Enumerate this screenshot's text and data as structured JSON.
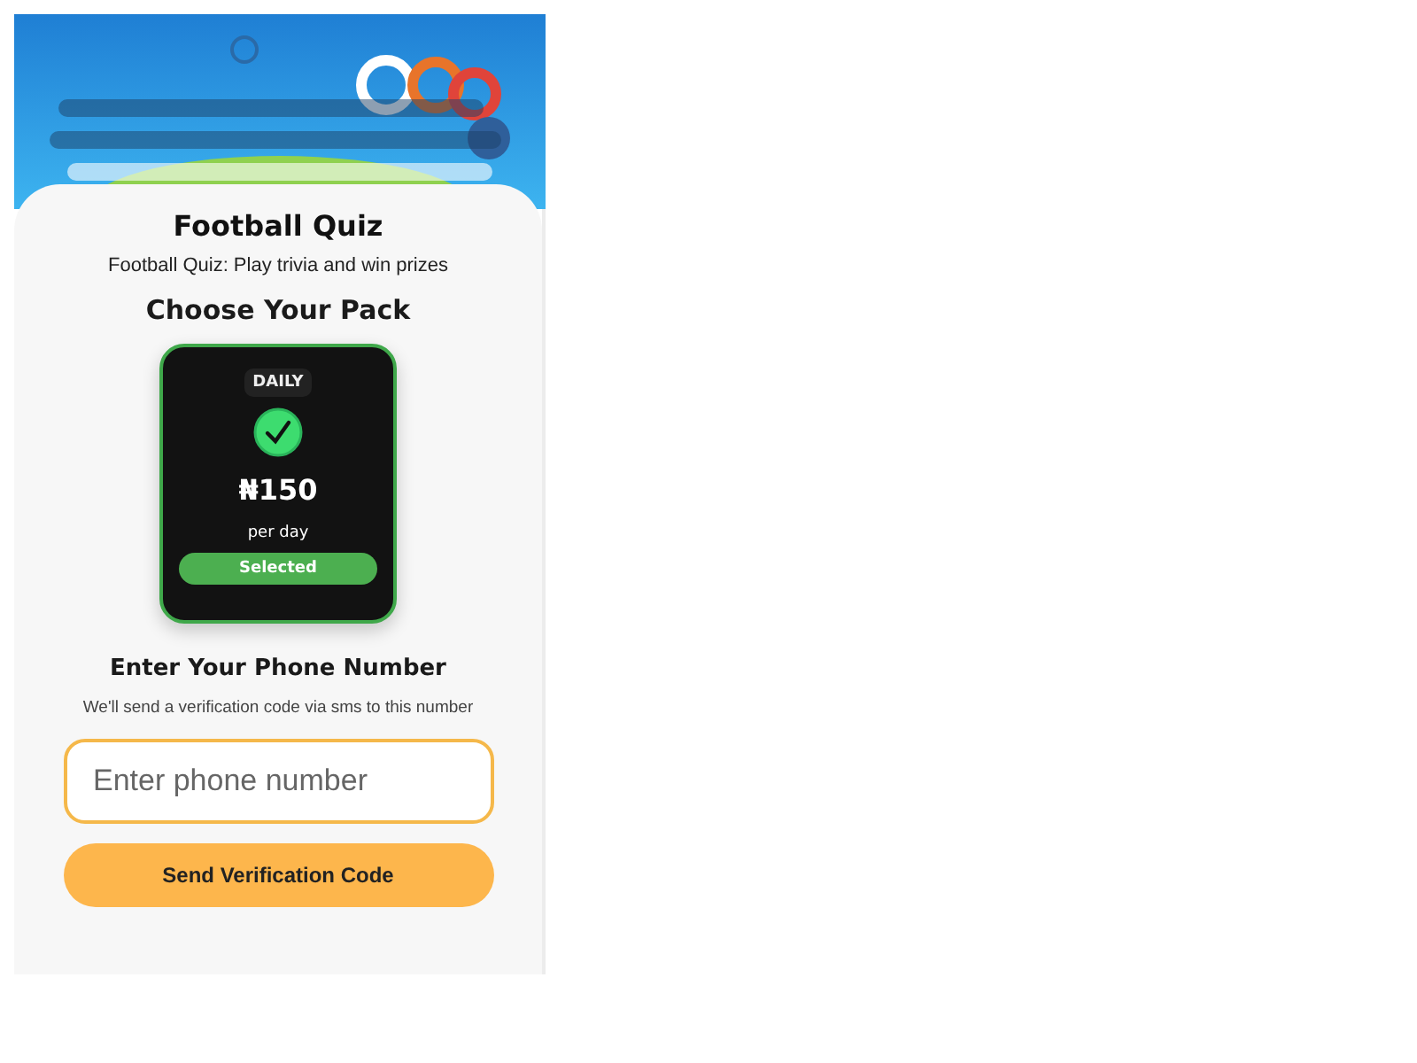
{
  "title": "Football Quiz",
  "subtitle": "Football Quiz: Play trivia and win prizes",
  "packs_heading": "Choose Your Pack",
  "packs": [
    {
      "period": "DAILY",
      "price": "₦150",
      "unit": "per day",
      "selected": true,
      "status": "Selected"
    }
  ],
  "phone": {
    "heading": "Enter Your Phone Number",
    "note": "We'll send a verification code via sms to this number",
    "placeholder": "Enter phone number"
  },
  "submit": "Send Verification Code"
}
